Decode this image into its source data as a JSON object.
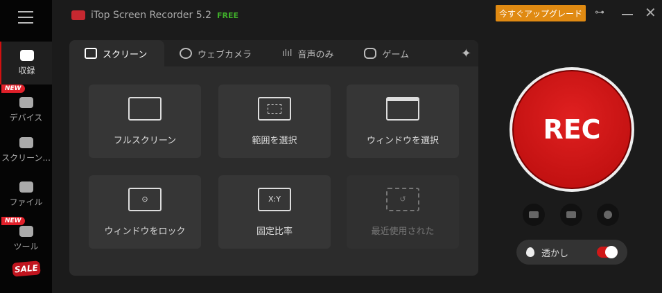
{
  "app": {
    "title": "iTop Screen Recorder 5.2",
    "edition": "FREE",
    "upgrade_label": "今すぐアップグレード"
  },
  "sidebar": {
    "items": [
      {
        "label": "収録",
        "icon": "video-camera-icon"
      },
      {
        "label": "デバイス",
        "icon": "devices-icon",
        "badge": "NEW"
      },
      {
        "label": "スクリーン...",
        "icon": "camera-icon"
      },
      {
        "label": "ファイル",
        "icon": "folder-icon"
      },
      {
        "label": "ツール",
        "icon": "tools-grid-icon",
        "badge": "NEW"
      }
    ],
    "sale": "SALE"
  },
  "tabs": [
    {
      "label": "スクリーン"
    },
    {
      "label": "ウェブカメラ"
    },
    {
      "label": "音声のみ"
    },
    {
      "label": "ゲーム"
    }
  ],
  "modes": [
    {
      "label": "フルスクリーン"
    },
    {
      "label": "範囲を選択"
    },
    {
      "label": "ウィンドウを選択"
    },
    {
      "label": "ウィンドウをロック"
    },
    {
      "label": "固定比率",
      "icon_text": "X:Y"
    },
    {
      "label": "最近使用された"
    }
  ],
  "rec": {
    "label": "REC"
  },
  "watermark": {
    "label": "透かし",
    "enabled": true
  },
  "colors": {
    "accent": "#d01818",
    "upgrade": "#e08a12",
    "free": "#3fae2a"
  }
}
